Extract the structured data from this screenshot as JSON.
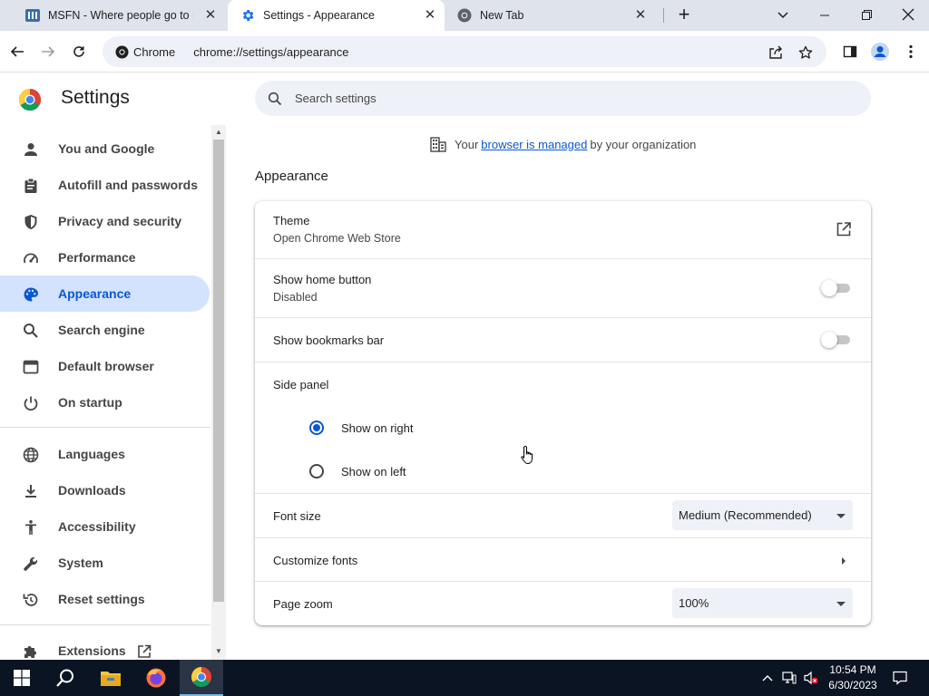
{
  "browser": {
    "tabs": [
      {
        "title": "MSFN - Where people go to know",
        "icon": "msfn-favicon"
      },
      {
        "title": "Settings - Appearance",
        "icon": "gear-icon"
      },
      {
        "title": "New Tab",
        "icon": "chrome-icon"
      }
    ],
    "omnibox": {
      "chip_label": "Chrome",
      "url": "chrome://settings/appearance"
    }
  },
  "settings": {
    "title": "Settings",
    "search_placeholder": "Search settings",
    "managed": {
      "prefix": "Your",
      "link": "browser is managed",
      "suffix": "by your organization"
    },
    "nav": [
      {
        "label": "You and Google",
        "icon": "person-icon"
      },
      {
        "label": "Autofill and passwords",
        "icon": "clipboard-icon"
      },
      {
        "label": "Privacy and security",
        "icon": "shield-icon"
      },
      {
        "label": "Performance",
        "icon": "gauge-icon"
      },
      {
        "label": "Appearance",
        "icon": "palette-icon",
        "active": true
      },
      {
        "label": "Search engine",
        "icon": "search-icon"
      },
      {
        "label": "Default browser",
        "icon": "browser-window-icon"
      },
      {
        "label": "On startup",
        "icon": "power-icon"
      },
      {
        "label": "Languages",
        "icon": "globe-icon"
      },
      {
        "label": "Downloads",
        "icon": "download-icon"
      },
      {
        "label": "Accessibility",
        "icon": "accessibility-icon"
      },
      {
        "label": "System",
        "icon": "wrench-icon"
      },
      {
        "label": "Reset settings",
        "icon": "reset-icon"
      },
      {
        "label": "Extensions",
        "icon": "puzzle-icon"
      }
    ],
    "appearance": {
      "section_title": "Appearance",
      "theme": {
        "label": "Theme",
        "sub": "Open Chrome Web Store"
      },
      "home_button": {
        "label": "Show home button",
        "sub": "Disabled",
        "enabled": false
      },
      "bookmarks_bar": {
        "label": "Show bookmarks bar",
        "enabled": false
      },
      "side_panel": {
        "label": "Side panel",
        "options": [
          "Show on right",
          "Show on left"
        ],
        "selected": "Show on right"
      },
      "font_size": {
        "label": "Font size",
        "value": "Medium (Recommended)"
      },
      "customize_fonts": {
        "label": "Customize fonts"
      },
      "page_zoom": {
        "label": "Page zoom",
        "value": "100%"
      }
    }
  },
  "taskbar": {
    "time": "10:54 PM",
    "date": "6/30/2023"
  },
  "colors": {
    "accent": "#0b57d0",
    "active_nav_bg": "#d3e3fd",
    "tabstrip_bg": "#dfe3eb",
    "taskbar_bg": "#0b1422"
  }
}
